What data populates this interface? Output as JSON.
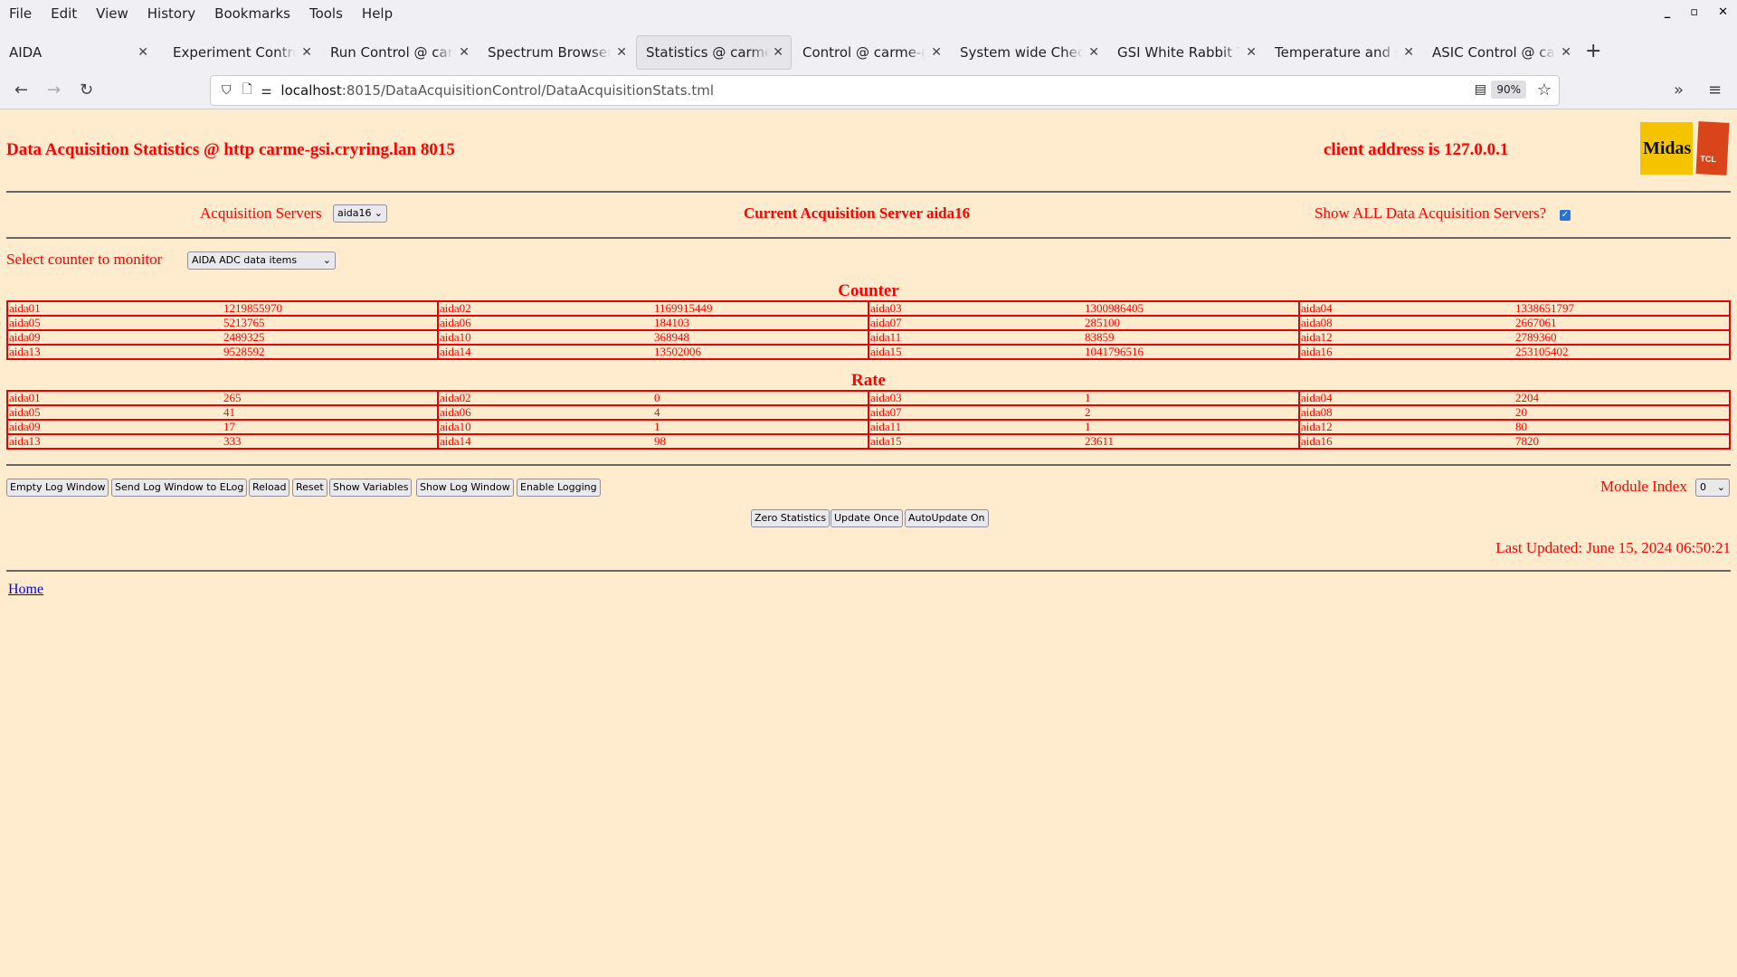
{
  "browser": {
    "menu": [
      "File",
      "Edit",
      "View",
      "History",
      "Bookmarks",
      "Tools",
      "Help"
    ],
    "tabs": [
      {
        "title": "AIDA",
        "active": false
      },
      {
        "title": "Experiment Control @ carme-gsi",
        "active": false
      },
      {
        "title": "Run Control @ carme-gsi",
        "active": false
      },
      {
        "title": "Spectrum Browser @ carme-gsi",
        "active": false
      },
      {
        "title": "Statistics @ carme-gsi",
        "active": true
      },
      {
        "title": "Control @ carme-gsi",
        "active": false
      },
      {
        "title": "System wide Checks (",
        "active": false
      },
      {
        "title": "GSI White Rabbit Tim",
        "active": false
      },
      {
        "title": "Temperature and stat",
        "active": false
      },
      {
        "title": "ASIC Control @ carme",
        "active": false
      }
    ],
    "url_host": "localhost",
    "url_path": ":8015/DataAcquisitionControl/DataAcquisitionStats.tml",
    "zoom": "90%"
  },
  "page": {
    "title": "Data Acquisition Statistics @ http carme-gsi.cryring.lan 8015",
    "client": "client address is 127.0.0.1",
    "acq_servers_label": "Acquisition Servers",
    "acq_server_value": "aida16",
    "current_server": "Current Acquisition Server aida16",
    "show_all_label": "Show ALL Data Acquisition Servers?",
    "show_all_checked": true,
    "select_counter_label": "Select counter to monitor",
    "select_counter_value": "AIDA ADC data items",
    "counter_heading": "Counter",
    "rate_heading": "Rate",
    "counter": [
      [
        "aida01",
        "1219855970",
        "aida02",
        "1169915449",
        "aida03",
        "1300986405",
        "aida04",
        "1338651797"
      ],
      [
        "aida05",
        "5213765",
        "aida06",
        "184103",
        "aida07",
        "285100",
        "aida08",
        "2667061"
      ],
      [
        "aida09",
        "2489325",
        "aida10",
        "368948",
        "aida11",
        "83859",
        "aida12",
        "2789360"
      ],
      [
        "aida13",
        "9528592",
        "aida14",
        "13502006",
        "aida15",
        "1041796516",
        "aida16",
        "253105402"
      ]
    ],
    "rate": [
      [
        "aida01",
        "265",
        "aida02",
        "0",
        "aida03",
        "1",
        "aida04",
        "2204"
      ],
      [
        "aida05",
        "41",
        "aida06",
        "4",
        "aida07",
        "2",
        "aida08",
        "20"
      ],
      [
        "aida09",
        "17",
        "aida10",
        "1",
        "aida11",
        "1",
        "aida12",
        "80"
      ],
      [
        "aida13",
        "333",
        "aida14",
        "98",
        "aida15",
        "23611",
        "aida16",
        "7820"
      ]
    ],
    "buttons1": [
      "Empty Log Window",
      "Send Log Window to ELog",
      "Reload",
      "Reset",
      "Show Variables",
      "Show Log Window",
      "Enable Logging"
    ],
    "module_index_label": "Module Index",
    "module_index_value": "0",
    "buttons2": [
      "Zero Statistics",
      "Update Once",
      "AutoUpdate On"
    ],
    "last_updated": "Last Updated: June 15, 2024 06:50:21",
    "home_link": "Home",
    "logos": [
      "Midas",
      "TCL POWERED"
    ]
  }
}
